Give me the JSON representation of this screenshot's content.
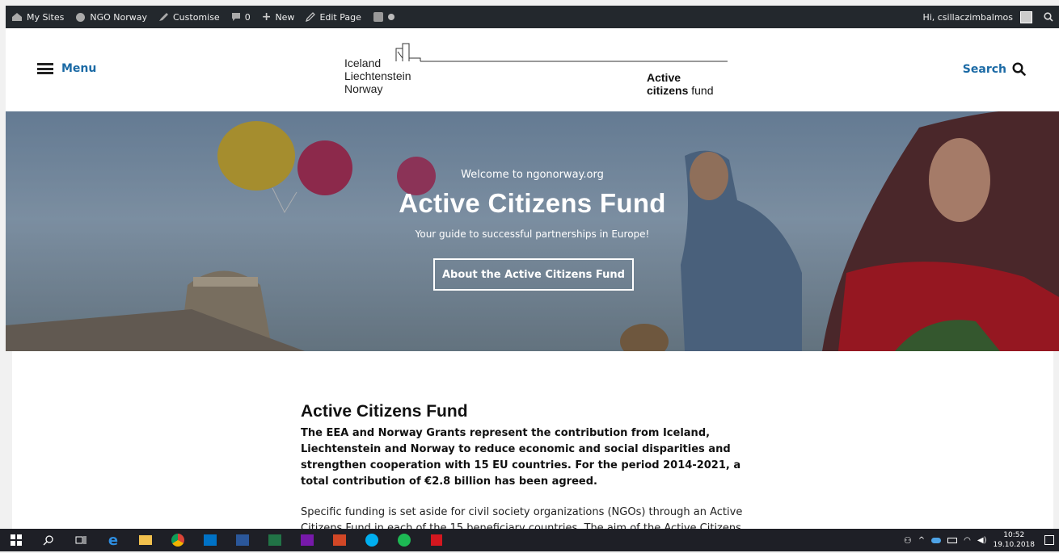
{
  "adminbar": {
    "my_sites": "My Sites",
    "site": "NGO Norway",
    "customise": "Customise",
    "comments": "0",
    "new": "New",
    "edit_page": "Edit Page",
    "greeting": "Hi, csillaczimbalmos"
  },
  "header": {
    "menu_label": "Menu",
    "search_label": "Search",
    "logo": {
      "line1": "Iceland",
      "line2": "Liechtenstein",
      "line3": "Norway",
      "right1": "Active",
      "right2_bold": "citizens",
      "right2_rest": " fund"
    }
  },
  "hero": {
    "welcome": "Welcome to ngonorway.org",
    "title": "Active Citizens Fund",
    "subtitle": "Your guide to successful partnerships in Europe!",
    "button": "About the Active Citizens Fund"
  },
  "article": {
    "title": "Active Citizens Fund",
    "lead": "The EEA and Norway Grants represent the contribution from Iceland, Liechtenstein and Norway to reduce economic and social disparities and strengthen cooperation with 15 EU countries. For the period 2014-2021, a total contribution of €2.8 billion has been agreed.",
    "paragraph": "Specific funding is set aside for civil society organizations (NGOs) through an Active Citizens Fund in each of the 15 beneficiary countries. The aim of the Active Citizens Fund"
  },
  "taskbar": {
    "time": "10:52",
    "date": "19.10.2018"
  },
  "colors": {
    "admin_bar": "#23282d",
    "accent_link": "#1b6aa5",
    "taskbar": "#1e1f26"
  }
}
